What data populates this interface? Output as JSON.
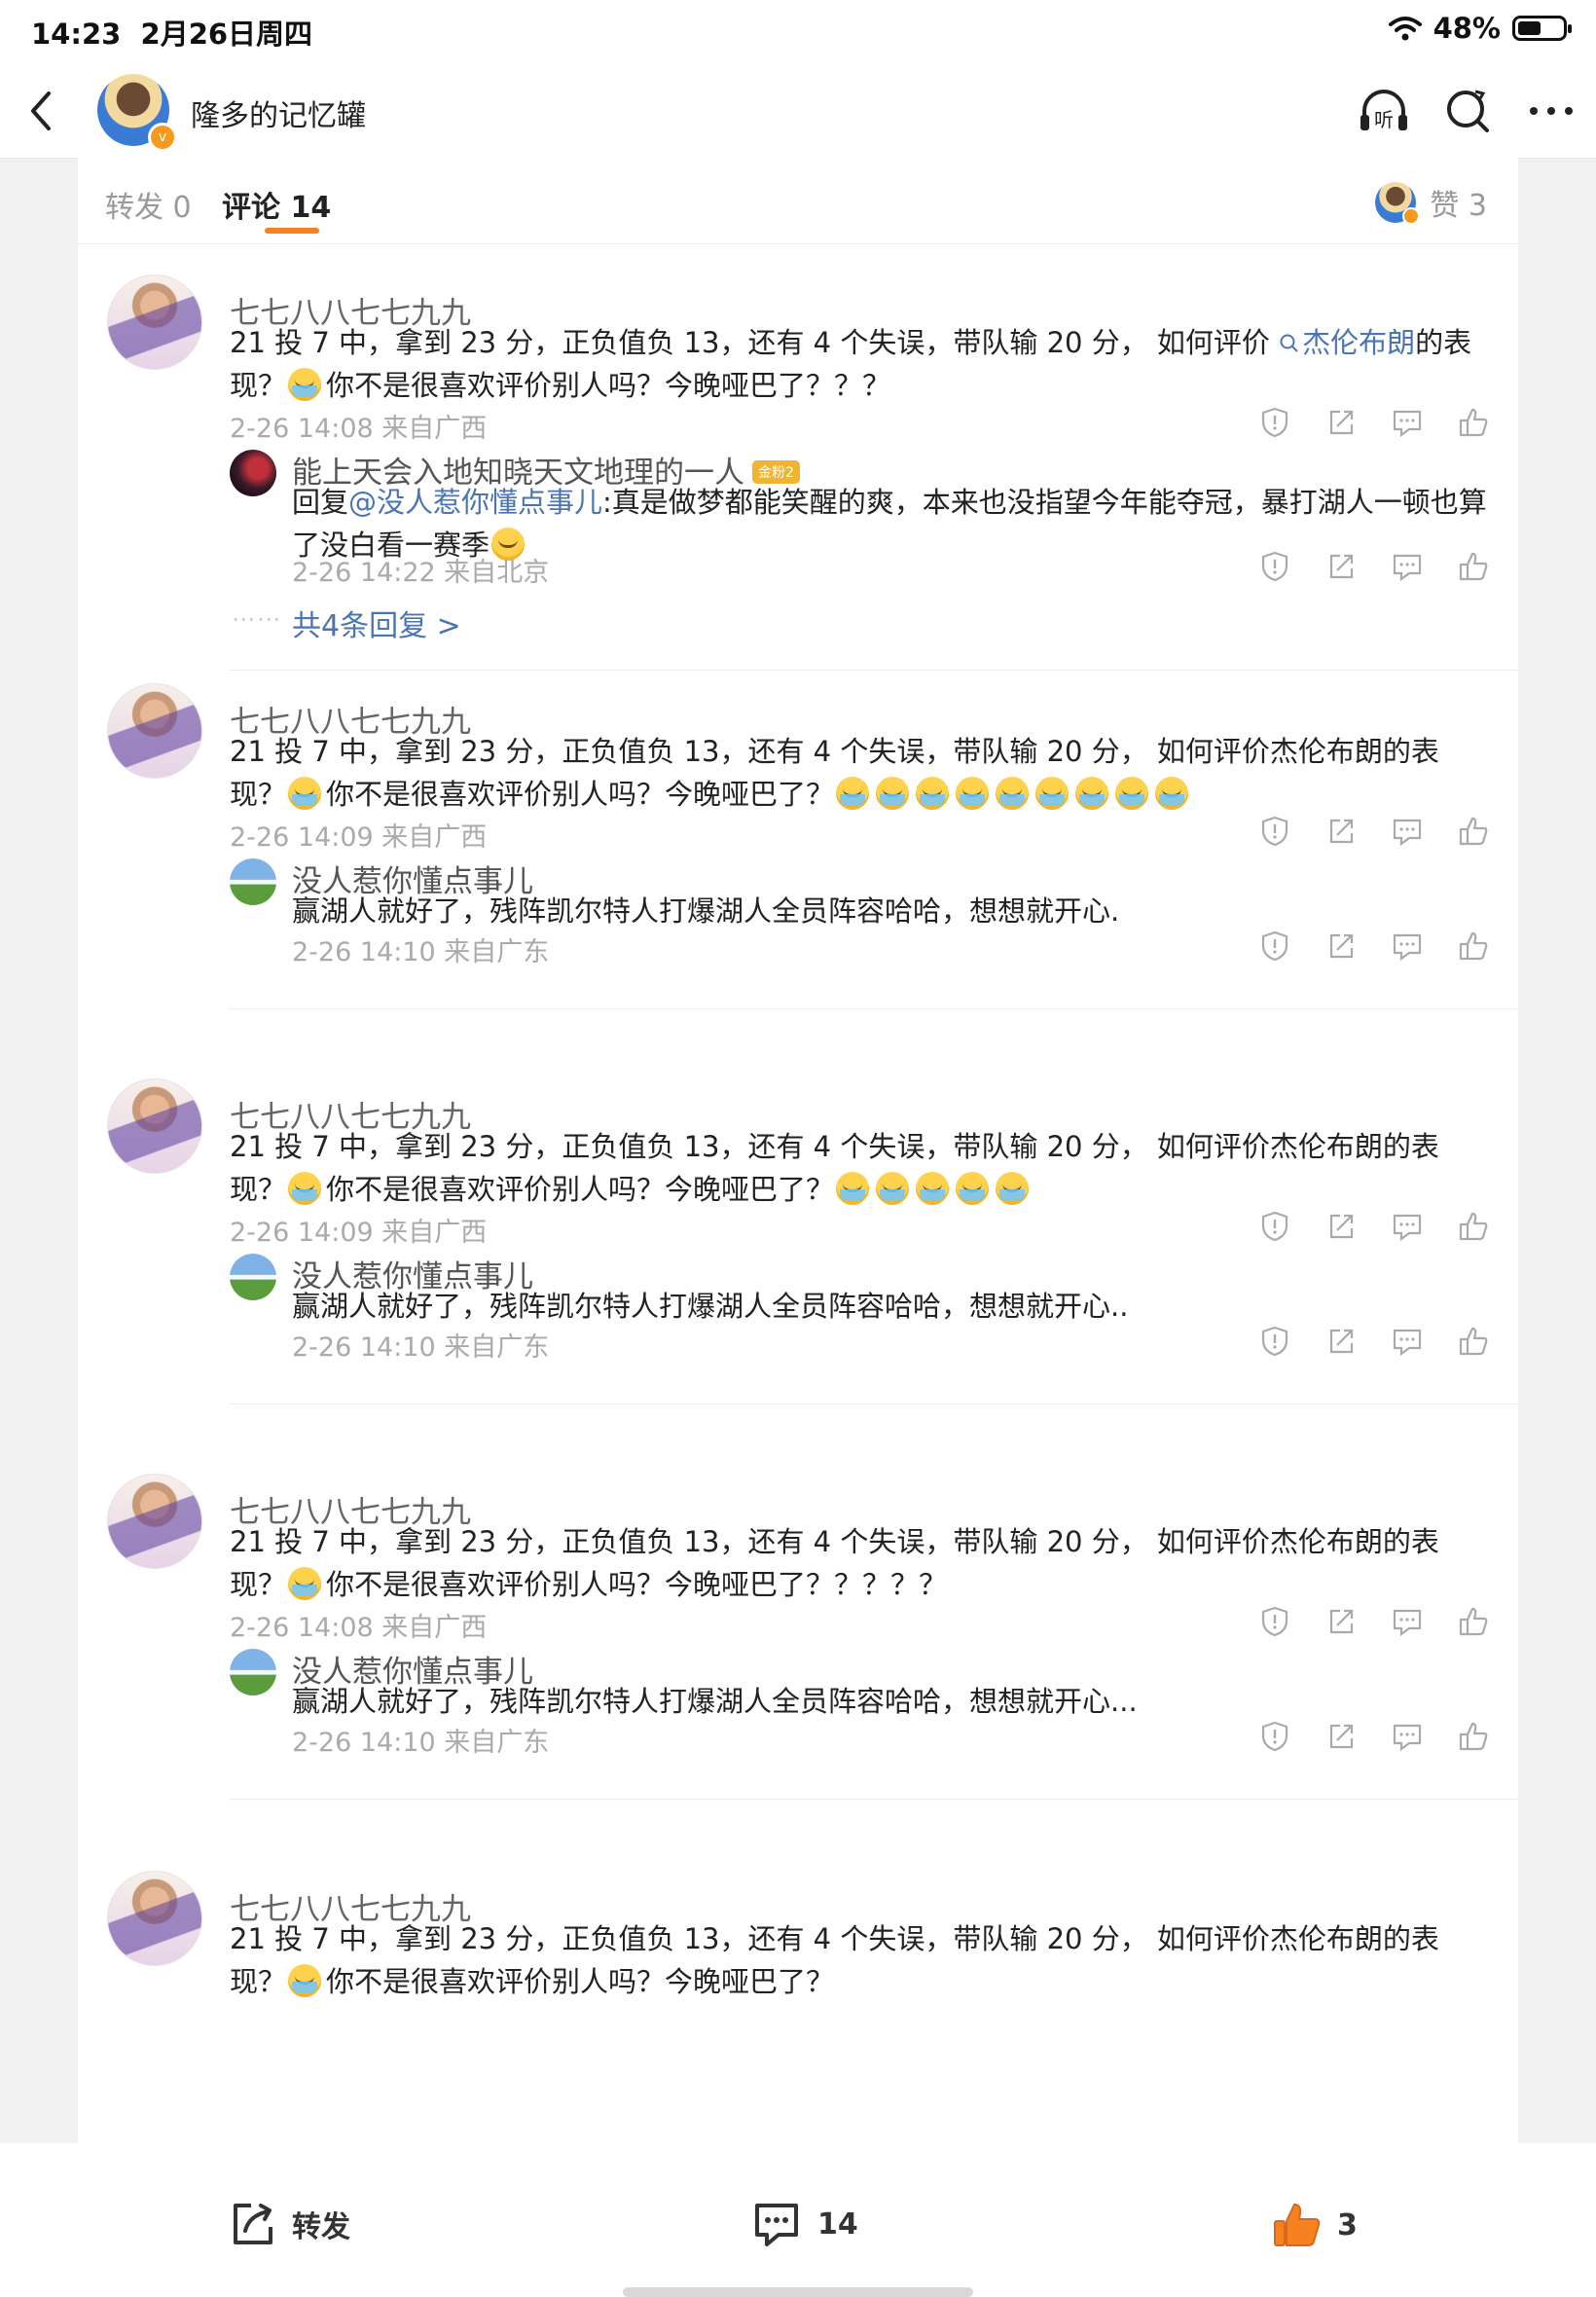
{
  "status_bar": {
    "time": "14:23",
    "date": "2月26日周四",
    "battery": "48%",
    "wifi_icon": "wifi-icon"
  },
  "nav": {
    "title": "隆多的记忆罐",
    "back_icon": "chevron-left-icon",
    "icons": [
      "headphones-listen-icon",
      "search-refresh-icon",
      "more-icon"
    ],
    "listen_label": "听"
  },
  "tabs": {
    "repost": "转发 0",
    "comment": "评论 14",
    "likes": "赞 3"
  },
  "comments": [
    {
      "name": "七七八八七七九九",
      "text_before": "21 投 7 中，拿到 23 分，正负值负 13，还有 4 个失误，带队输 20 分，  如何评价 ",
      "link": "杰伦布朗",
      "text_after": "的表现？",
      "text_tail": "你不是很喜欢评价别人吗？今晚哑巴了？？？",
      "meta": "2-26 14:08 来自广西",
      "reply": {
        "name": "能上天会入地知晓天文地理的一人",
        "badge": "金粉2",
        "prefix": "回复",
        "mention": "@没人惹你懂点事儿",
        "text": ":真是做梦都能笑醒的爽，本来也没指望今年能夺冠，暴打湖人一顿也算了没白看一赛季",
        "meta": "2-26 14:22 来自北京"
      },
      "more": "共4条回复 >",
      "more_dots": "⋯⋯"
    },
    {
      "name": "七七八八七七九九",
      "text_line1": "21 投 7 中，拿到 23 分，正负值负 13，还有 4 个失误，带队输 20 分，  如何评价杰伦布朗的表",
      "text_line2_a": "现？",
      "text_line2_b": "你不是很喜欢评价别人吗？今晚哑巴了？",
      "meta": "2-26 14:09 来自广西",
      "reply": {
        "name": "没人惹你懂点事儿",
        "text": "赢湖人就好了，残阵凯尔特人打爆湖人全员阵容哈哈，想想就开心.",
        "meta": "2-26 14:10 来自广东"
      }
    },
    {
      "name": "七七八八七七九九",
      "text_line1": "21 投 7 中，拿到 23 分，正负值负 13，还有 4 个失误，带队输 20 分，  如何评价杰伦布朗的表",
      "text_line2_a": "现？",
      "text_line2_b": "你不是很喜欢评价别人吗？今晚哑巴了？",
      "meta": "2-26 14:09 来自广西",
      "reply": {
        "name": "没人惹你懂点事儿",
        "text": "赢湖人就好了，残阵凯尔特人打爆湖人全员阵容哈哈，想想就开心..",
        "meta": "2-26 14:10 来自广东"
      }
    },
    {
      "name": "七七八八七七九九",
      "text_line1": "21 投 7 中，拿到 23 分，正负值负 13，还有 4 个失误，带队输 20 分，  如何评价杰伦布朗的表",
      "text_line2_a": "现？",
      "text_line2_b": "你不是很喜欢评价别人吗？今晚哑巴了？？？？？",
      "meta": "2-26 14:08 来自广西",
      "reply": {
        "name": "没人惹你懂点事儿",
        "text": "赢湖人就好了，残阵凯尔特人打爆湖人全员阵容哈哈，想想就开心...",
        "meta": "2-26 14:10 来自广东"
      }
    },
    {
      "name": "七七八八七七九九",
      "text_line1": "21 投 7 中，拿到 23 分，正负值负 13，还有 4 个失误，带队输 20 分，  如何评价杰伦布朗的表",
      "text_line2_a": "现？",
      "text_line2_b": "你不是很喜欢评价别人吗？今晚哑巴了？"
    }
  ],
  "bottom_bar": {
    "repost": "转发",
    "comment_count": "14",
    "like_count": "3"
  },
  "colors": {
    "accent": "#f5821f",
    "link": "#4a74b3",
    "meta": "#aaaaaa"
  }
}
